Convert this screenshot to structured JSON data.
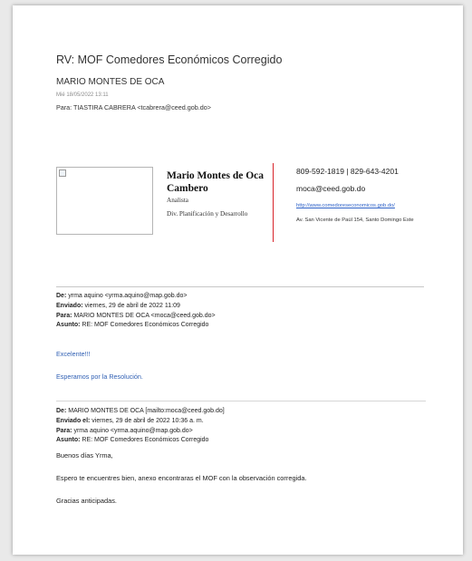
{
  "email": {
    "subject": "RV: MOF Comedores Económicos Corregido",
    "sender": "MARIO MONTES DE OCA",
    "date": "Mié 18/05/2022 13:11",
    "to": "Para: TIASTIRA CABRERA <tcabrera@ceed.gob.do>"
  },
  "signature": {
    "name": "Mario Montes de Oca Cambero",
    "role": "Analista",
    "division": "Div. Planificación y Desarrollo",
    "phone": "809-592-1819 | 829-643-4201",
    "email": "moca@ceed.gob.do",
    "website": "http://www.comedoreseconomicos.gob.do/",
    "address": "Av. San Vicente de Paúl 154, Santo Domingo Este"
  },
  "quoted1": {
    "from_label": "De:",
    "from": "yrma aquino <yrma.aquino@map.gob.do>",
    "sent_label": "Enviado:",
    "sent": "viernes, 29 de abril de 2022 11:09",
    "to_label": "Para:",
    "to": "MARIO MONTES DE OCA <moca@ceed.gob.do>",
    "subject_label": "Asunto:",
    "subject": "RE: MOF Comedores Económicos Corregido",
    "line1": "Excelente!!!",
    "line2": "Esperamos por la Resolución."
  },
  "quoted2": {
    "from_label": "De:",
    "from": "MARIO MONTES DE OCA [mailto:moca@ceed.gob.do]",
    "sent_label": "Enviado el:",
    "sent": "viernes, 29 de abril de 2022 10:36 a. m.",
    "to_label": "Para:",
    "to": "yrma aquino <yrma.aquino@map.gob.do>",
    "subject_label": "Asunto:",
    "subject": "RE: MOF Comedores Económicos Corregido",
    "greeting": "Buenos días Yrma,",
    "body": "Espero te encuentres bien, anexo encontraras el MOF con la observación corregida.",
    "closing": "Gracias anticipadas."
  }
}
